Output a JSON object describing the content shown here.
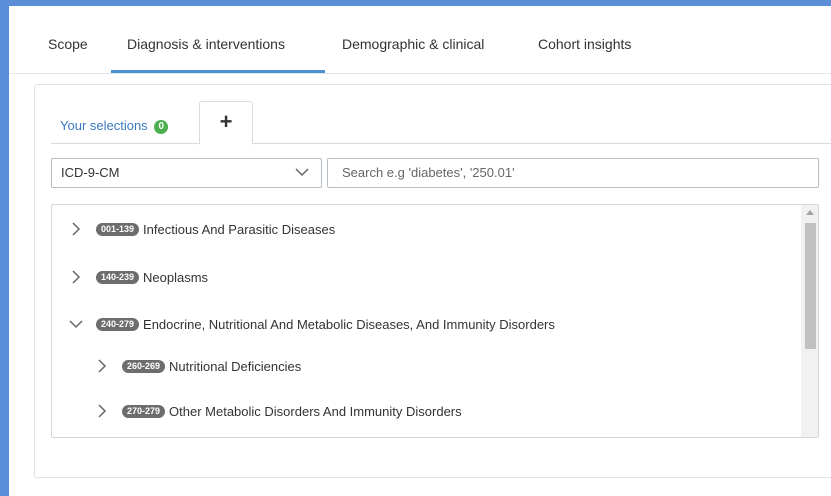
{
  "nav": {
    "tabs": [
      {
        "label": "Scope"
      },
      {
        "label": "Diagnosis & interventions",
        "active": true
      },
      {
        "label": "Demographic & clinical"
      },
      {
        "label": "Cohort insights"
      }
    ]
  },
  "selections": {
    "label": "Your selections",
    "count": "0",
    "add_label": "+"
  },
  "code_system": {
    "selected": "ICD-9-CM"
  },
  "search": {
    "placeholder": "Search e.g 'diabetes', '250.01'"
  },
  "tree": [
    {
      "code": "001-139",
      "label": "Infectious And Parasitic Diseases",
      "expanded": false,
      "level": 0
    },
    {
      "code": "140-239",
      "label": "Neoplasms",
      "expanded": false,
      "level": 0
    },
    {
      "code": "240-279",
      "label": "Endocrine, Nutritional And Metabolic Diseases, And Immunity Disorders",
      "expanded": true,
      "level": 0
    },
    {
      "code": "260-269",
      "label": "Nutritional Deficiencies",
      "expanded": false,
      "level": 1
    },
    {
      "code": "270-279",
      "label": "Other Metabolic Disorders And Immunity Disorders",
      "expanded": false,
      "level": 1
    }
  ],
  "colors": {
    "accent": "#4a8fcf",
    "badge_green": "#4caf50",
    "code_badge": "#6d6d6d",
    "frame_border": "#5b8ed8"
  },
  "icons": {
    "collapsed": "chevron-right-icon",
    "expanded": "chevron-down-icon",
    "dropdown": "chevron-down-icon",
    "add": "plus-icon"
  }
}
